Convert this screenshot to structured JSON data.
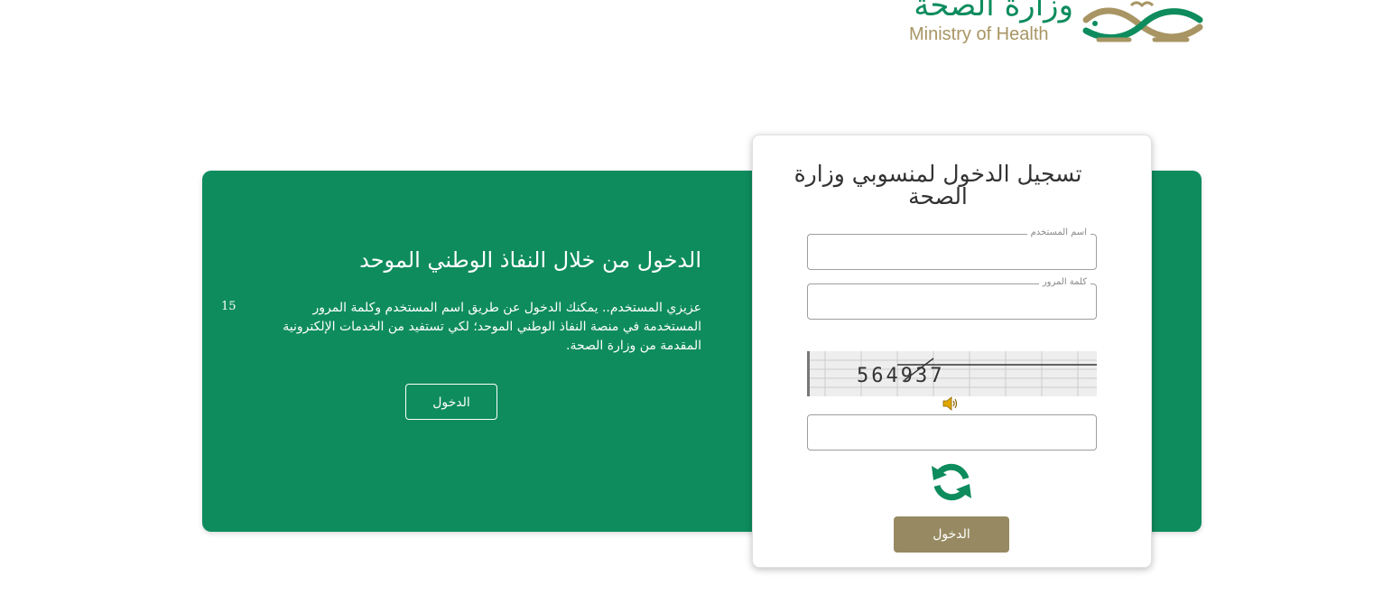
{
  "header": {
    "logo_arabic": "وزارة الصحة",
    "logo_english": "Ministry of Health"
  },
  "nafath": {
    "title": "الدخول من خلال النفاذ الوطني الموحد",
    "description": "عزيزي المستخدم.. يمكنك الدخول عن طريق اسم المستخدم وكلمة المرور المستخدمة في منصة النفاذ الوطني الموحد؛ لكي تستفيد من الخدمات الإلكترونية المقدمة من وزارة الصحة.",
    "number": "15",
    "button_label": "الدخول"
  },
  "login": {
    "title": "تسجيل الدخول لمنسوبي وزارة الصحة",
    "username_label": "اسم المستخدم",
    "username_value": "",
    "password_label": "كلمة المرور",
    "password_value": "",
    "captcha_text": "564937",
    "captcha_value": "",
    "submit_label": "الدخول"
  },
  "colors": {
    "brand_green": "#0e8c5e",
    "brand_gold": "#978a62",
    "logo_gold": "#a89563"
  },
  "icons": {
    "speaker": "speaker-icon",
    "refresh": "refresh-icon"
  }
}
